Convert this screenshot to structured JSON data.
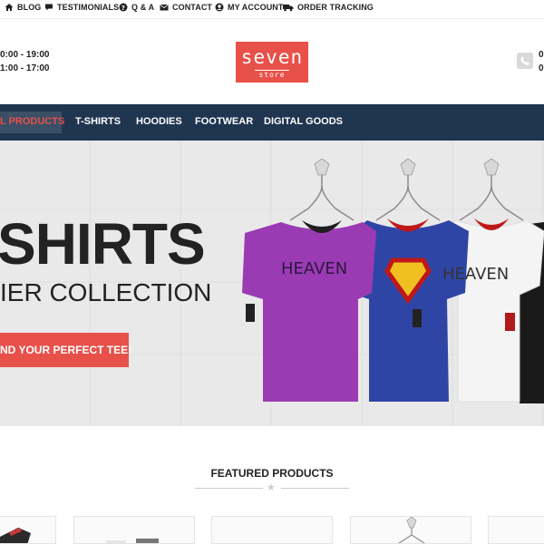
{
  "topbar": {
    "links": [
      {
        "label": "BLOG",
        "icon": "home-icon"
      },
      {
        "label": "TESTIMONIALS",
        "icon": "speech-bubble-icon"
      },
      {
        "label": "Q & A",
        "icon": "question-circle-icon"
      },
      {
        "label": "CONTACT",
        "icon": "envelope-icon"
      },
      {
        "label": "MY ACCOUNT",
        "icon": "user-circle-icon"
      },
      {
        "label": "ORDER TRACKING",
        "icon": "truck-icon"
      }
    ]
  },
  "header": {
    "hours_line1": "0:00 - 19:00",
    "hours_line2": "1:00 - 17:00",
    "logo_main": "seven",
    "logo_sub": "store",
    "phone_line1": "0",
    "phone_line2": "0"
  },
  "nav": {
    "items": [
      {
        "label": "L PRODUCTS",
        "active": true
      },
      {
        "label": "T-SHIRTS"
      },
      {
        "label": "HOODIES"
      },
      {
        "label": "FOOTWEAR"
      },
      {
        "label": "DIGITAL GOODS"
      }
    ]
  },
  "hero": {
    "title": "SHIRTS",
    "subtitle": "IER COLLECTION",
    "button": "ND YOUR PERFECT TEE!",
    "shirt_text": "HEAVEN"
  },
  "featured": {
    "title": "FEATURED PRODUCTS"
  },
  "colors": {
    "accent": "#e8504a",
    "nav_bg": "#1f3550"
  }
}
